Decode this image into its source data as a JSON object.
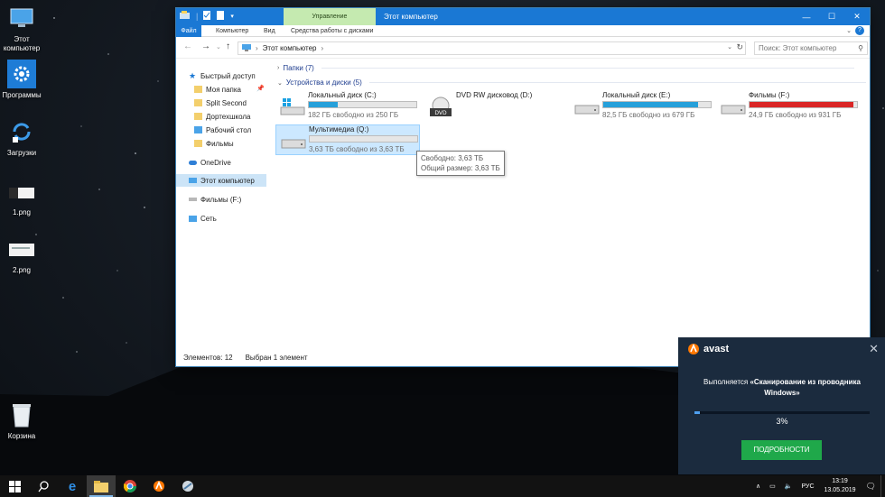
{
  "desktop": {
    "icons": [
      {
        "label": "Этот\nкомпьютер",
        "icon": "this-pc-icon"
      },
      {
        "label": "Программы",
        "icon": "gear-icon"
      },
      {
        "label": "Загрузки",
        "icon": "sync-icon"
      },
      {
        "label": "1.png",
        "icon": "image-file-icon"
      },
      {
        "label": "2.png",
        "icon": "image-file-icon"
      },
      {
        "label": "Корзина",
        "icon": "recycle-bin-icon"
      }
    ]
  },
  "explorer": {
    "title": "Этот компьютер",
    "context_tab": "Управление",
    "ribbon_tabs": [
      "Файл",
      "Компьютер",
      "Вид",
      "Средства работы с дисками"
    ],
    "address": "Этот компьютер",
    "search_placeholder": "Поиск: Этот компьютер",
    "nav": {
      "quick_access": "Быстрый доступ",
      "items": [
        "Моя папка",
        "Split Second",
        "Дортехшкола",
        "Рабочий стол",
        "Фильмы",
        "OneDrive",
        "Этот компьютер",
        "Фильмы (F:)",
        "Сеть"
      ]
    },
    "groups": {
      "folders": "Папки (7)",
      "devices": "Устройства и диски (5)"
    },
    "drives": [
      {
        "name": "Локальный диск (C:)",
        "info": "182 ГБ свободно из 250 ГБ",
        "used": 0.27,
        "color": "#26a0da",
        "icon": "windows-drive-icon"
      },
      {
        "name": "DVD RW дисковод (D:)",
        "info": "",
        "used": null,
        "color": "",
        "icon": "dvd-drive-icon"
      },
      {
        "name": "Локальный диск (E:)",
        "info": "82,5 ГБ свободно из 679 ГБ",
        "used": 0.88,
        "color": "#26a0da",
        "icon": "hard-drive-icon"
      },
      {
        "name": "Фильмы (F:)",
        "info": "24,9 ГБ свободно из 931 ГБ",
        "used": 0.97,
        "color": "#da2626",
        "icon": "hard-drive-icon"
      },
      {
        "name": "Мультимедиа (Q:)",
        "info": "3,63 ТБ свободно из 3,63 ТБ",
        "used": 0.0,
        "color": "#26a0da",
        "icon": "hard-drive-icon"
      }
    ],
    "tooltip": {
      "line1": "Свободно: 3,63 ТБ",
      "line2": "Общий размер: 3,63 ТБ"
    },
    "status": {
      "count": "Элементов: 12",
      "selected": "Выбран 1 элемент"
    }
  },
  "avast": {
    "brand": "avast",
    "message_prefix": "Выполняется ",
    "message_bold": "«Сканирование из проводника Windows»",
    "progress": 0.03,
    "percent": "3%",
    "button": "ПОДРОБНОСТИ"
  },
  "taskbar": {
    "language": "РУС",
    "time": "13:19",
    "date": "13.05.2019"
  }
}
